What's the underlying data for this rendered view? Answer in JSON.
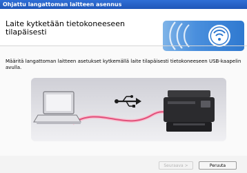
{
  "window": {
    "title": "Ohjattu langattoman laitteen asennus"
  },
  "header": {
    "title_line1": "Laite kytketään tietokoneeseen",
    "title_line2": "tilapäisesti"
  },
  "body": {
    "description": "Määritä langattoman laitteen asetukset kytkemällä laite tilapäisesti tietokoneeseen USB-kaapelin avulla."
  },
  "buttons": {
    "next_label": "Seuraava >",
    "cancel_label": "Peruuta"
  },
  "icons": {
    "banner": "wireless-signal-icon",
    "laptop": "laptop-icon",
    "usb": "usb-icon",
    "printer": "printer-icon"
  },
  "colors": {
    "titlebar": "#1f56b8",
    "banner": "#4a8fdd",
    "cable": "#e0507a"
  }
}
